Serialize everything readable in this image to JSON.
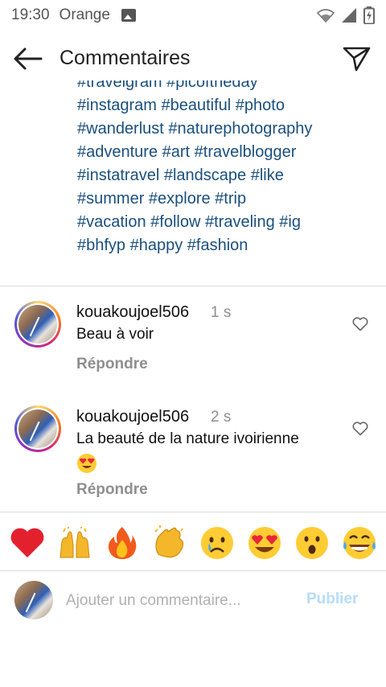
{
  "status_bar": {
    "time": "19:30",
    "carrier": "Orange",
    "icons": [
      "image-icon",
      "wifi-icon",
      "signal-icon",
      "battery-charging-icon"
    ]
  },
  "header": {
    "title": "Commentaires",
    "back_icon": "arrow-left-icon",
    "share_icon": "paper-plane-icon"
  },
  "caption": {
    "lines": [
      "#travelgram #picoftheday",
      "#instagram #beautiful #photo",
      "#wanderlust #naturephotography",
      "#adventure #art #travelblogger",
      "#instatravel #landscape #like",
      "#summer #explore #trip",
      "#vacation #follow #traveling #ig",
      "#bhfyp #happy #fashion"
    ]
  },
  "comments": [
    {
      "username": "kouakoujoel506",
      "time": "1 s",
      "text": "Beau à voir",
      "reply_label": "Répondre"
    },
    {
      "username": "kouakoujoel506",
      "time": "2 s",
      "text": "La beauté de la nature ivoirienne",
      "emoji": "heart-eyes-emoji",
      "reply_label": "Répondre"
    }
  ],
  "reactions": [
    {
      "name": "red-heart",
      "glyph": "❤️"
    },
    {
      "name": "raising-hands",
      "glyph": "🙌"
    },
    {
      "name": "fire",
      "glyph": "🔥"
    },
    {
      "name": "clapping-hands",
      "glyph": "👏"
    },
    {
      "name": "crying-face",
      "glyph": "😢"
    },
    {
      "name": "heart-eyes",
      "glyph": "😍"
    },
    {
      "name": "astonished-face",
      "glyph": "😮"
    },
    {
      "name": "tears-of-joy",
      "glyph": "😂"
    }
  ],
  "composer": {
    "placeholder": "Ajouter un commentaire...",
    "publish_label": "Publier"
  },
  "colors": {
    "hashtag": "#1a4f7e",
    "secondary_text": "#8e8e8e",
    "publish_disabled": "#b6dcf7",
    "divider": "#dbdbdb"
  }
}
